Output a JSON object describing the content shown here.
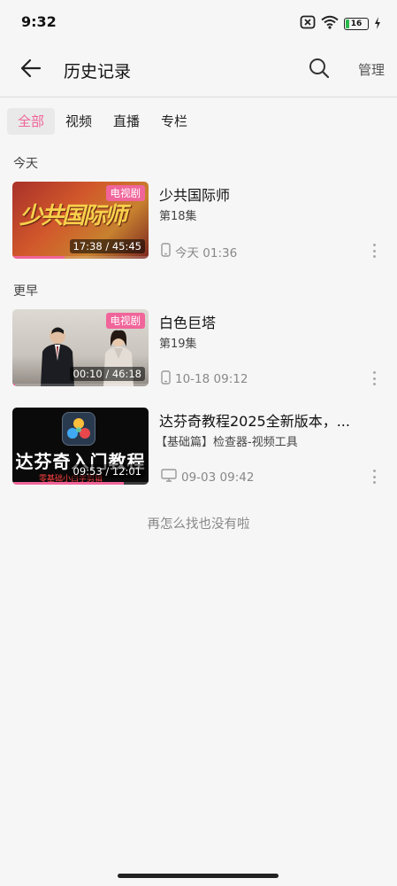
{
  "status_bar": {
    "time": "9:32",
    "battery_level": "16",
    "icons": [
      "sim-off-icon",
      "wifi-icon",
      "battery-icon",
      "charging-icon"
    ]
  },
  "header": {
    "title": "历史记录",
    "manage_label": "管理",
    "icons": [
      "back-arrow-icon",
      "search-icon"
    ]
  },
  "filter_tabs": [
    {
      "label": "全部",
      "active": true
    },
    {
      "label": "视频",
      "active": false
    },
    {
      "label": "直播",
      "active": false
    },
    {
      "label": "专栏",
      "active": false
    }
  ],
  "sections": {
    "today_label": "今天",
    "earlier_label": "更早"
  },
  "items": [
    {
      "title": "少共国际师",
      "subtitle": "第18集",
      "badge": "电视剧",
      "duration": "17:38 / 45:45",
      "progress": 0.385,
      "device_icon": "phone-icon",
      "time": "今天 01:36",
      "thumb_text": "少共国际师"
    },
    {
      "title": "白色巨塔",
      "subtitle": "第19集",
      "badge": "电视剧",
      "duration": "00:10 / 46:18",
      "progress": 0.004,
      "device_icon": "phone-icon",
      "time": "10-18 09:12"
    },
    {
      "title": "达芬奇教程2025全新版本，...",
      "subtitle": "【基础篇】检查器-视频工具",
      "duration": "09:53 / 12:01",
      "progress": 0.82,
      "device_icon": "tv-icon",
      "time": "09-03 09:42",
      "thumb_text": "达芬奇入门教程",
      "thumb_subtext": "零基础小白学剪辑"
    }
  ],
  "colors": {
    "accent": "#f0659a",
    "background": "#f6f6f6"
  },
  "end_text": "再怎么找也没有啦"
}
